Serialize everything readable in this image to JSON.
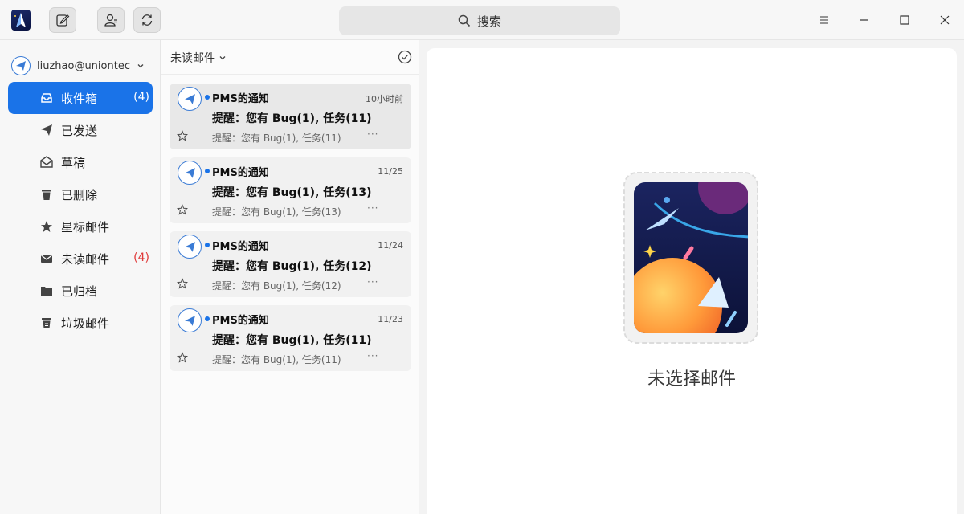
{
  "titlebar": {
    "search_placeholder": "搜索"
  },
  "sidebar": {
    "account": "liuzhao@uniontec···",
    "items": [
      {
        "label": "收件箱",
        "count": "(4)",
        "icon": "inbox-icon"
      },
      {
        "label": "已发送",
        "count": "",
        "icon": "send-icon"
      },
      {
        "label": "草稿",
        "count": "",
        "icon": "draft-icon"
      },
      {
        "label": "已删除",
        "count": "",
        "icon": "trash-icon"
      },
      {
        "label": "星标邮件",
        "count": "",
        "icon": "star-icon"
      },
      {
        "label": "未读邮件",
        "count": "(4)",
        "icon": "unread-mail-icon"
      },
      {
        "label": "已归档",
        "count": "",
        "icon": "folder-icon"
      },
      {
        "label": "垃圾邮件",
        "count": "",
        "icon": "spam-icon"
      }
    ]
  },
  "list": {
    "filter": "未读邮件",
    "mails": [
      {
        "sender": "PMS的通知",
        "time": "10小时前",
        "subject": "提醒：您有 Bug(1), 任务(11)",
        "preview": "提醒：您有 Bug(1), 任务(11)",
        "more": "···"
      },
      {
        "sender": "PMS的通知",
        "time": "11/25",
        "subject": "提醒：您有 Bug(1), 任务(13)",
        "preview": "提醒：您有 Bug(1), 任务(13)",
        "more": "···"
      },
      {
        "sender": "PMS的通知",
        "time": "11/24",
        "subject": "提醒：您有 Bug(1), 任务(12)",
        "preview": "提醒：您有 Bug(1), 任务(12)",
        "more": "···"
      },
      {
        "sender": "PMS的通知",
        "time": "11/23",
        "subject": "提醒：您有 Bug(1), 任务(11)",
        "preview": "提醒：您有 Bug(1), 任务(11)",
        "more": "···"
      }
    ]
  },
  "reader": {
    "empty_text": "未选择邮件"
  },
  "colors": {
    "accent": "#1a73e8",
    "unread_count": "#e03a3a"
  }
}
